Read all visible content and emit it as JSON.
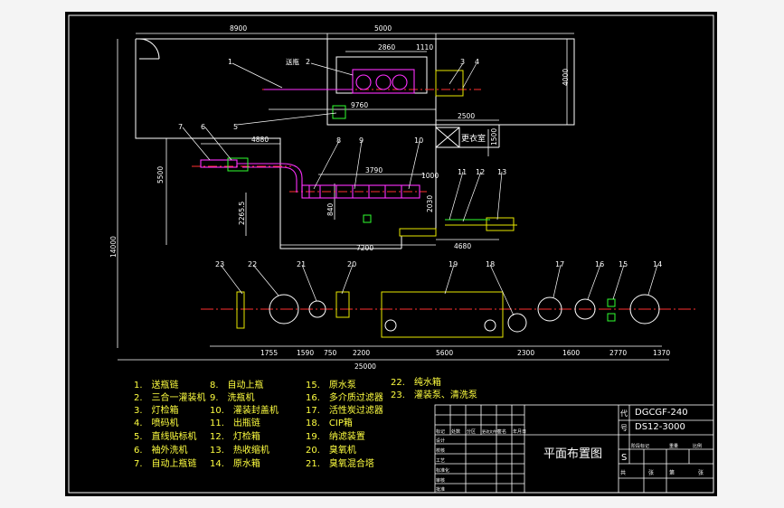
{
  "drawing": {
    "title": "平面布置图",
    "code_label_1": "代",
    "code_label_2": "号",
    "model_1": "DGCGF-240",
    "model_2": "DS12-3000",
    "stage_mark": "S",
    "title_block_cells": [
      "标记",
      "处数",
      "分区",
      "更改文件号",
      "签名",
      "年月日"
    ],
    "title_block_rows": [
      "设计",
      "校核",
      "工艺",
      "标准化",
      "审核",
      "批准"
    ],
    "scale_cells": [
      "阶段标记",
      "重量",
      "比例"
    ],
    "sheet_cells": [
      "共",
      "张",
      "第",
      "张"
    ]
  },
  "dimensions": {
    "d8900": "8900",
    "d5000": "5000",
    "d2860": "2860",
    "d1110": "1110",
    "d4000": "4000",
    "d9760": "9760",
    "d2500": "2500",
    "d4880": "4880",
    "d3790": "3790",
    "d1000": "1000",
    "d5500": "5500",
    "d2265": "2265.5",
    "d2030": "2030",
    "d4680": "4680",
    "d7200": "7200",
    "d14000": "14000",
    "d1755": "1755",
    "d1590": "1590",
    "d750": "750",
    "d2200": "2200",
    "d5600": "5600",
    "d2300": "2300",
    "d1600": "1600",
    "d2770": "2770",
    "d1370": "1370",
    "d25000": "25000",
    "d1500": "1500",
    "d840": "840"
  },
  "room_labels": {
    "changing": "更衣室",
    "conveyor": "送瓶"
  },
  "balloons": [
    "1",
    "2",
    "3",
    "4",
    "5",
    "6",
    "7",
    "8",
    "9",
    "10",
    "11",
    "12",
    "13",
    "14",
    "15",
    "16",
    "17",
    "18",
    "19",
    "20",
    "21",
    "22",
    "23"
  ],
  "legend": {
    "col1": [
      "1.　送瓶链",
      "2.　三合一灌装机",
      "3.　灯检箱",
      "4.　喷码机",
      "5.　直线贴标机",
      "6.　袖外洗机",
      "7.　自动上瓶链"
    ],
    "col2": [
      "8.　自动上瓶",
      "9.　洗瓶机",
      "10.　灌装封盖机",
      "11.　出瓶链",
      "12.　灯检箱",
      "13.　热收缩机",
      "14.　原水箱"
    ],
    "col3": [
      "15.　原水泵",
      "16.　多介质过滤器",
      "17.　活性炭过滤器",
      "18.　CIP箱",
      "19.　纳滤装置",
      "20.　臭氧机",
      "21.　臭氧混合塔"
    ],
    "col4": [
      "22.　纯水箱",
      "23.　灌装泵、清洗泵"
    ]
  }
}
